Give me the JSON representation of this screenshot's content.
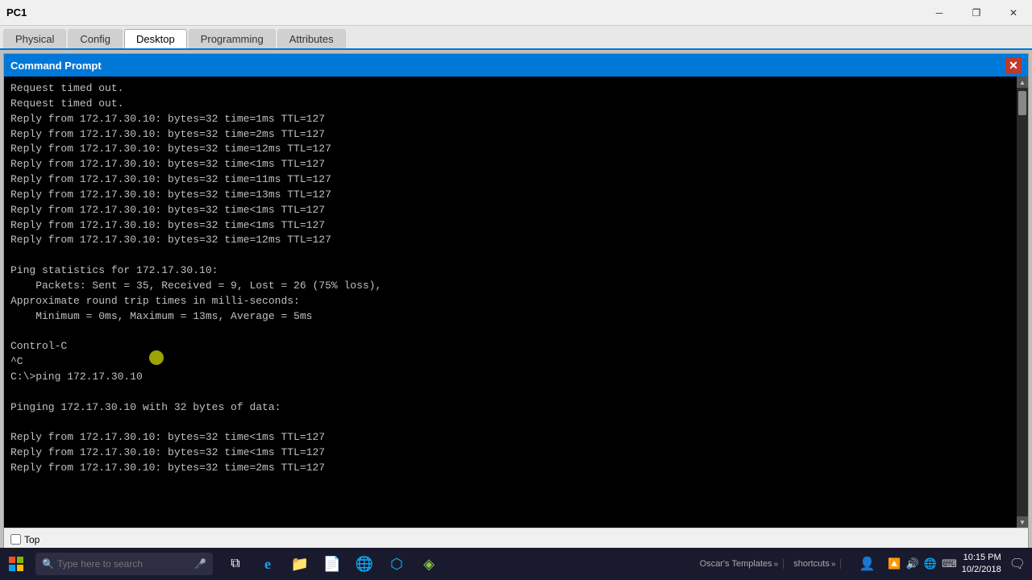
{
  "window": {
    "title": "PC1",
    "tabs": [
      "Physical",
      "Config",
      "Desktop",
      "Programming",
      "Attributes"
    ],
    "active_tab": "Desktop"
  },
  "cmd": {
    "title": "Command Prompt",
    "close_btn": "✕",
    "content_lines": [
      "Request timed out.",
      "Request timed out.",
      "Reply from 172.17.30.10: bytes=32 time=1ms TTL=127",
      "Reply from 172.17.30.10: bytes=32 time=2ms TTL=127",
      "Reply from 172.17.30.10: bytes=32 time=12ms TTL=127",
      "Reply from 172.17.30.10: bytes=32 time<1ms TTL=127",
      "Reply from 172.17.30.10: bytes=32 time=11ms TTL=127",
      "Reply from 172.17.30.10: bytes=32 time=13ms TTL=127",
      "Reply from 172.17.30.10: bytes=32 time<1ms TTL=127",
      "Reply from 172.17.30.10: bytes=32 time<1ms TTL=127",
      "Reply from 172.17.30.10: bytes=32 time=12ms TTL=127",
      "",
      "Ping statistics for 172.17.30.10:",
      "    Packets: Sent = 35, Received = 9, Lost = 26 (75% loss),",
      "Approximate round trip times in milli-seconds:",
      "    Minimum = 0ms, Maximum = 13ms, Average = 5ms",
      "",
      "Control-C",
      "^C",
      "C:\\>ping 172.17.30.10",
      "",
      "Pinging 172.17.30.10 with 32 bytes of data:",
      "",
      "Reply from 172.17.30.10: bytes=32 time<1ms TTL=127",
      "Reply from 172.17.30.10: bytes=32 time<1ms TTL=127",
      "Reply from 172.17.30.10: bytes=32 time=2ms TTL=127"
    ]
  },
  "bottom_bar": {
    "top_label": "Top"
  },
  "taskbar": {
    "search_placeholder": "Type here to search",
    "clock_time": "10:15 PM",
    "clock_date": "10/2/2018",
    "oscars_label": "Oscar's Templates",
    "shortcuts_label": "shortcuts",
    "apps": [
      {
        "name": "task-view",
        "icon": "⧉"
      },
      {
        "name": "edge",
        "icon": "e"
      },
      {
        "name": "file-explorer",
        "icon": "📁"
      },
      {
        "name": "notepad",
        "icon": "📝"
      },
      {
        "name": "chrome",
        "icon": "⊕"
      },
      {
        "name": "cisco-app1",
        "icon": "⬡"
      },
      {
        "name": "cisco-app2",
        "icon": "◈"
      }
    ],
    "tray_icons": [
      "🔼",
      "🔊",
      "🌐",
      "⌨"
    ]
  }
}
